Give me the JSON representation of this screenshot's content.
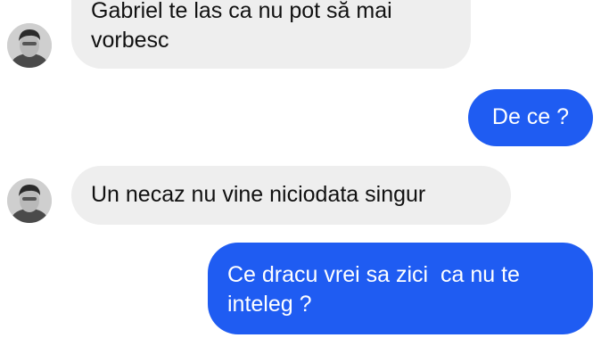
{
  "conversation": {
    "messages": [
      {
        "sender": "contact",
        "text": "Gabriel te las ca nu pot să mai\nvorbesc"
      },
      {
        "sender": "me",
        "text": "De ce ?"
      },
      {
        "sender": "contact",
        "text": "Un necaz nu vine niciodata singur"
      },
      {
        "sender": "me",
        "text": "Ce dracu vrei sa zici  ca nu te\ninteleg ?"
      }
    ],
    "colors": {
      "incoming_bubble": "#eeeeee",
      "outgoing_bubble": "#1f5cf2",
      "outgoing_text": "#ffffff",
      "incoming_text": "#111111"
    },
    "contact_avatar_icon": "person-photo-avatar-icon"
  }
}
